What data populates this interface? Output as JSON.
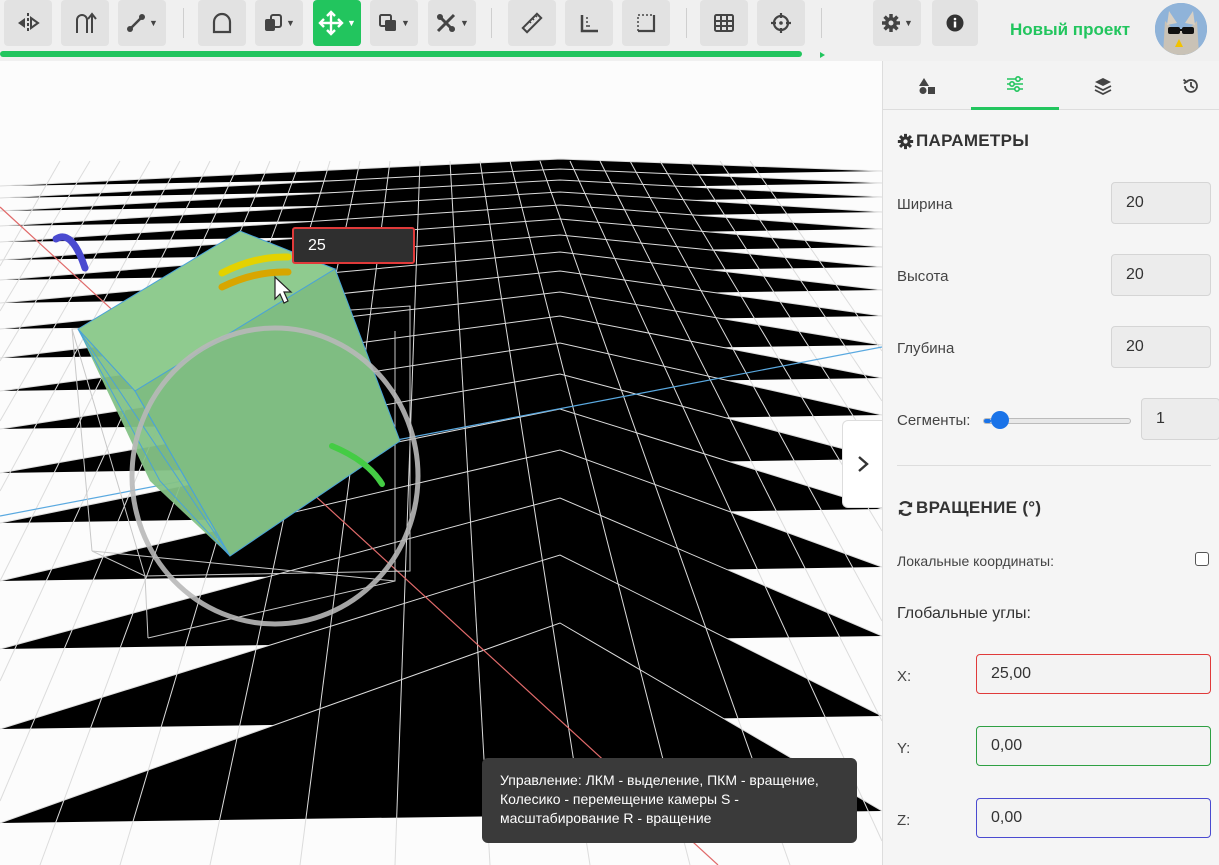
{
  "project": {
    "title": "Новый проект"
  },
  "value_popup": {
    "value": "25"
  },
  "tooltip": {
    "text": "Управление: ЛКМ - выделение, ПКМ - вращение, Колесико - перемещение камеры S - масштабирование R - вращение"
  },
  "params": {
    "title": "ПАРАМЕТРЫ",
    "width_label": "Ширина",
    "width_value": "20",
    "height_label": "Высота",
    "height_value": "20",
    "depth_label": "Глубина",
    "depth_value": "20",
    "segments_label": "Сегменты:",
    "segments_value": "1",
    "segments_fraction": 0.05
  },
  "rotation": {
    "title": "ВРАЩЕНИЕ (°)",
    "local_label": "Локальные координаты:",
    "local_checked": false,
    "global_label": "Глобальные углы:",
    "x_label": "X:",
    "x_value": "25,00",
    "y_label": "Y:",
    "y_value": "0,00",
    "z_label": "Z:",
    "z_value": "0,00"
  },
  "colors": {
    "accent": "#22c55e",
    "x_axis": "#e03a3a",
    "y_axis": "#2ea043",
    "z_axis": "#4a4ad0",
    "slider": "#1a73e8"
  }
}
